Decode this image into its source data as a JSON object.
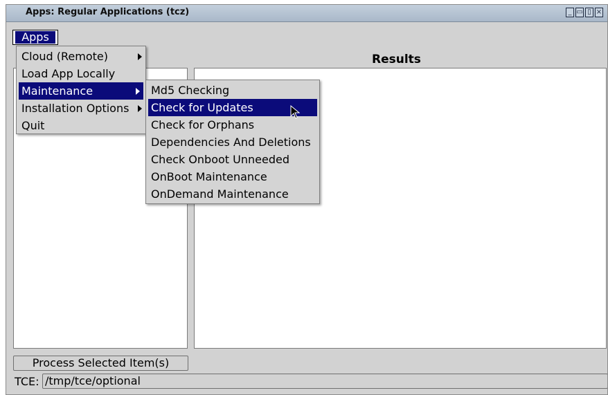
{
  "window": {
    "title": "Apps: Regular Applications (tcz)"
  },
  "menubar": {
    "apps_label": "Apps"
  },
  "results": {
    "label": "Results"
  },
  "menu": {
    "items": [
      {
        "label": "Cloud (Remote)",
        "has_submenu": true
      },
      {
        "label": "Load App Locally",
        "has_submenu": false
      },
      {
        "label": "Maintenance",
        "has_submenu": true,
        "selected": true
      },
      {
        "label": "Installation Options",
        "has_submenu": true
      },
      {
        "label": "Quit",
        "has_submenu": false
      }
    ]
  },
  "submenu": {
    "items": [
      {
        "label": "Md5 Checking"
      },
      {
        "label": "Check for Updates",
        "selected": true
      },
      {
        "label": "Check for Orphans"
      },
      {
        "label": "Dependencies And Deletions"
      },
      {
        "label": "Check Onboot Unneeded"
      },
      {
        "label": "OnBoot Maintenance"
      },
      {
        "label": "OnDemand Maintenance"
      }
    ]
  },
  "process_button": "Process Selected Item(s)",
  "tce": {
    "label": "TCE:",
    "value": "/tmp/tce/optional"
  },
  "colors": {
    "selection": "#0b0b7a",
    "window_bg": "#d2d2d2",
    "titlebar": "#b4c2d2"
  }
}
